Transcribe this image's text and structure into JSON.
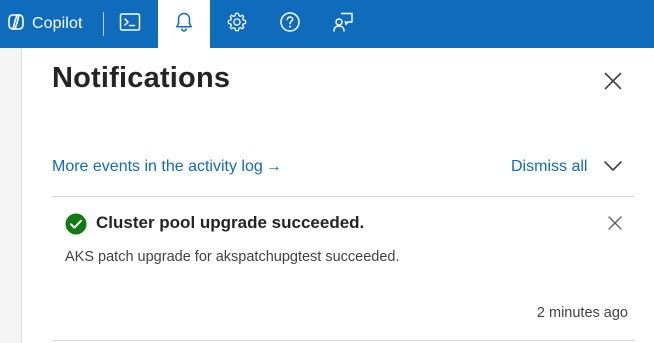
{
  "topbar": {
    "copilot_label": "Copilot",
    "icons": [
      "copilot-icon",
      "cloud-shell-icon",
      "bell-icon",
      "gear-icon",
      "help-icon",
      "feedback-icon"
    ],
    "active": "notifications"
  },
  "panel": {
    "title": "Notifications"
  },
  "actions": {
    "activity_link": "More events in the activity log",
    "activity_arrow": "→",
    "dismiss_all": "Dismiss all"
  },
  "notifications": [
    {
      "status": "success",
      "title": "Cluster pool upgrade succeeded.",
      "description": "AKS patch upgrade for akspatchupgtest succeeded.",
      "time": "2 minutes ago"
    }
  ],
  "colors": {
    "brand": "#0f6cbd",
    "success": "#107c10",
    "text": "#242424",
    "link": "#0f6cbd"
  }
}
